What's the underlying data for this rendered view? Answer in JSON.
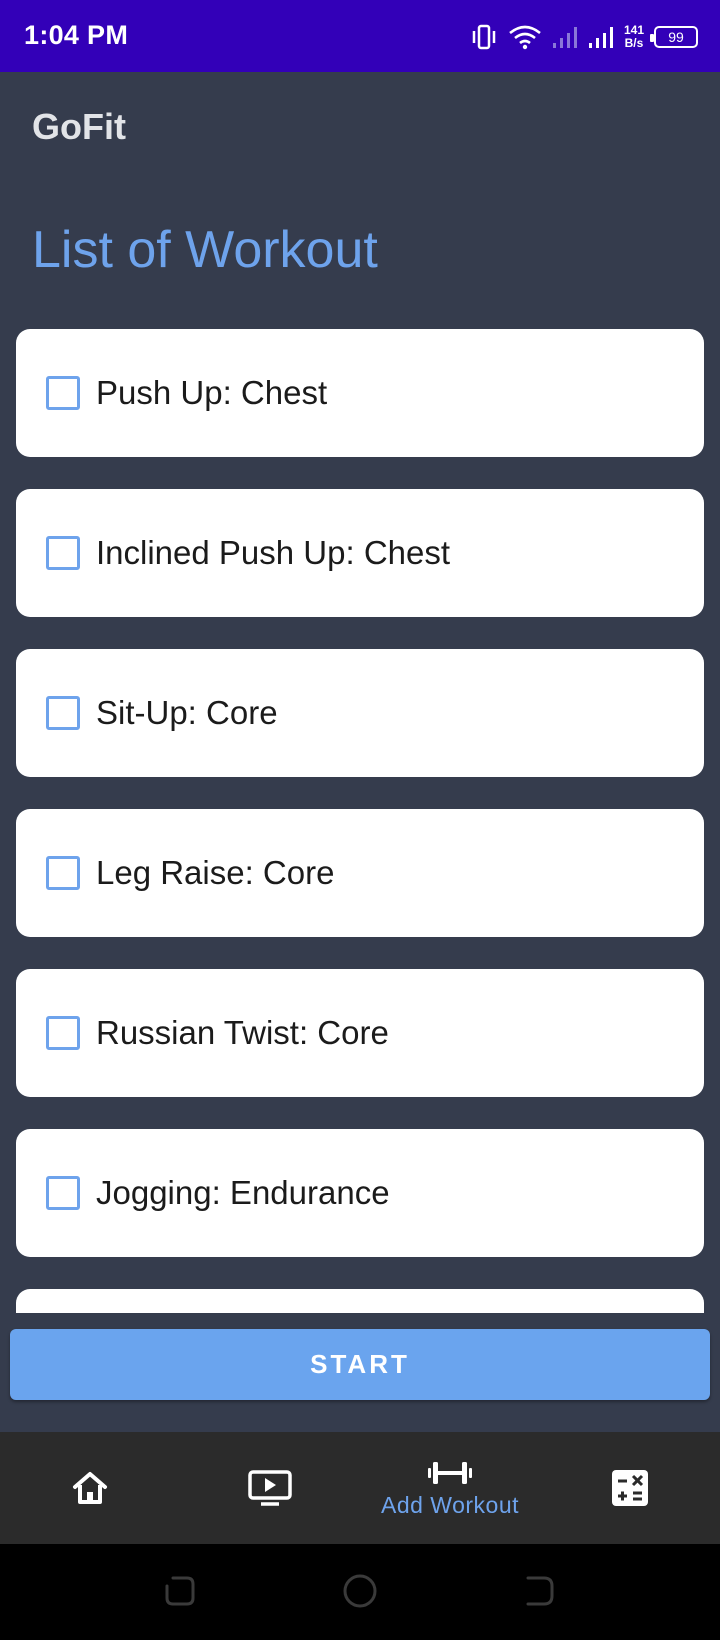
{
  "status_bar": {
    "time": "1:04 PM",
    "net_speed_value": "141",
    "net_speed_unit": "B/s",
    "battery_level": "99",
    "icons": [
      "vibrate-icon",
      "wifi-icon",
      "signal-icon",
      "signal-icon",
      "battery-icon"
    ]
  },
  "app": {
    "title": "GoFit"
  },
  "page": {
    "heading": "List of Workout"
  },
  "workouts": [
    {
      "label": "Push Up: Chest",
      "checked": false
    },
    {
      "label": "Inclined Push Up: Chest",
      "checked": false
    },
    {
      "label": "Sit-Up: Core",
      "checked": false
    },
    {
      "label": "Leg Raise: Core",
      "checked": false
    },
    {
      "label": "Russian Twist: Core",
      "checked": false
    },
    {
      "label": "Jogging: Endurance",
      "checked": false
    }
  ],
  "start_button": {
    "label": "START"
  },
  "bottom_nav": {
    "items": [
      {
        "icon": "home-icon",
        "label": ""
      },
      {
        "icon": "video-play-icon",
        "label": ""
      },
      {
        "icon": "dumbbell-icon",
        "label": "Add Workout",
        "active": true
      },
      {
        "icon": "calculator-icon",
        "label": ""
      }
    ]
  },
  "colors": {
    "status_bar": "#3300b8",
    "background": "#353c4d",
    "accent": "#6ea3ec",
    "button": "#6aa4ee",
    "nav_bar": "#2b2b2b"
  }
}
